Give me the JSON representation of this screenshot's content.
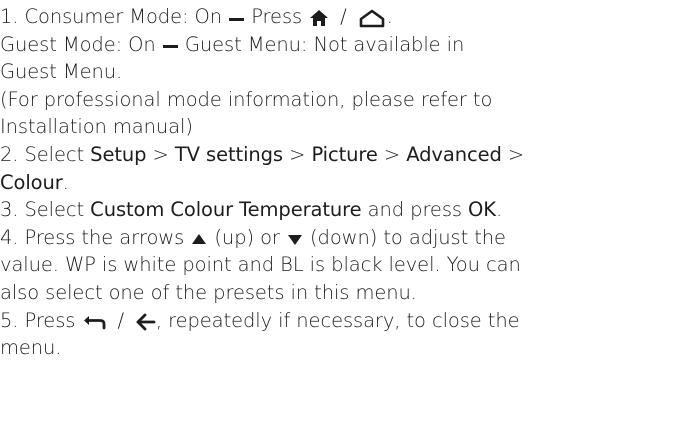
{
  "step1": {
    "text1": "1. Consumer Mode: On ",
    "text2": " Press ",
    "slash": "/",
    "end": ".",
    "icons": [
      "dash-icon",
      "home-filled-icon",
      "home-outline-icon"
    ]
  },
  "guest": {
    "text1": "Guest Mode: On ",
    "text2": " Guest Menu: Not available in",
    "text3": "Guest Menu."
  },
  "professional": {
    "line1": "(For professional mode information, please refer to",
    "line2": "Installation manual)"
  },
  "step2": {
    "prefix": "2. Select ",
    "setup": "Setup",
    "gt": " > ",
    "tv_settings": "TV settings",
    "picture": "Picture",
    "advanced": "Advanced",
    "gt_end": " >",
    "colour": "Colour",
    "end": "."
  },
  "step3": {
    "prefix": "3. Select ",
    "custom": "Custom Colour Temperature",
    "middle": " and press ",
    "ok": "OK",
    "end": "."
  },
  "step4": {
    "prefix": "4. Press the arrows ",
    "up": " (up) or ",
    "down": " (down) to adjust the",
    "line2": "value. WP is white point and BL is black level. You can",
    "line3": "also select one of the presets in this menu."
  },
  "step5": {
    "prefix": "5. Press ",
    "slash": "/",
    "rest": ", repeatedly if necessary, to close the",
    "line2": "menu."
  }
}
